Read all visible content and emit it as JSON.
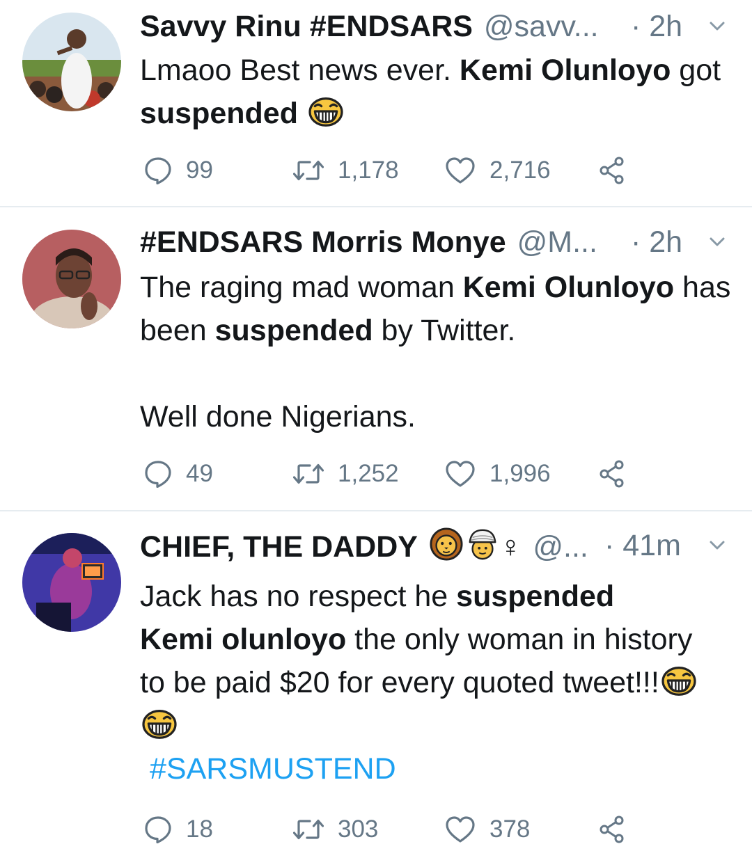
{
  "tweets": [
    {
      "name": "Savvy Rinu #ENDSARS",
      "handle": "@savv...",
      "time": "· 2h",
      "text": {
        "part1": "Lmaoo Best news ever. ",
        "bold1": "Kemi Olunloyo",
        "part2": " got ",
        "bold2": "suspended"
      },
      "emoji": "face-with-tears-of-joy",
      "replies": "99",
      "retweets": "1,178",
      "likes": "2,716"
    },
    {
      "name": "#ENDSARS Morris Monye",
      "handle": "@M...",
      "time": "· 2h",
      "text": {
        "part1": "The raging mad woman ",
        "bold1": "Kemi Olunloyo",
        "part2": " has been ",
        "bold2": "suspended",
        "part3": " by Twitter.",
        "para2": "Well done Nigerians."
      },
      "replies": "49",
      "retweets": "1,252",
      "likes": "1,996"
    },
    {
      "name": "CHIEF, THE DADDY",
      "name_emojis": [
        "lion-face",
        "person-with-turban",
        "female-sign"
      ],
      "female_sign": "♀",
      "handle": "@...",
      "time": "· 41m",
      "text": {
        "part1": "Jack has no respect he ",
        "bold1": "suspended",
        "bold2": "Kemi olunloyo",
        "part2": " the only woman in history to be  paid $20 for every quoted tweet!!!",
        "hashtag": "#SARSMUSTEND"
      },
      "emojis": [
        "face-with-tears-of-joy",
        "face-with-tears-of-joy"
      ],
      "replies": "18",
      "retweets": "303",
      "likes": "378"
    }
  ],
  "colors": {
    "text": "#14171a",
    "muted": "#657786",
    "link": "#1da1f2",
    "divider": "#e6ecf0"
  }
}
